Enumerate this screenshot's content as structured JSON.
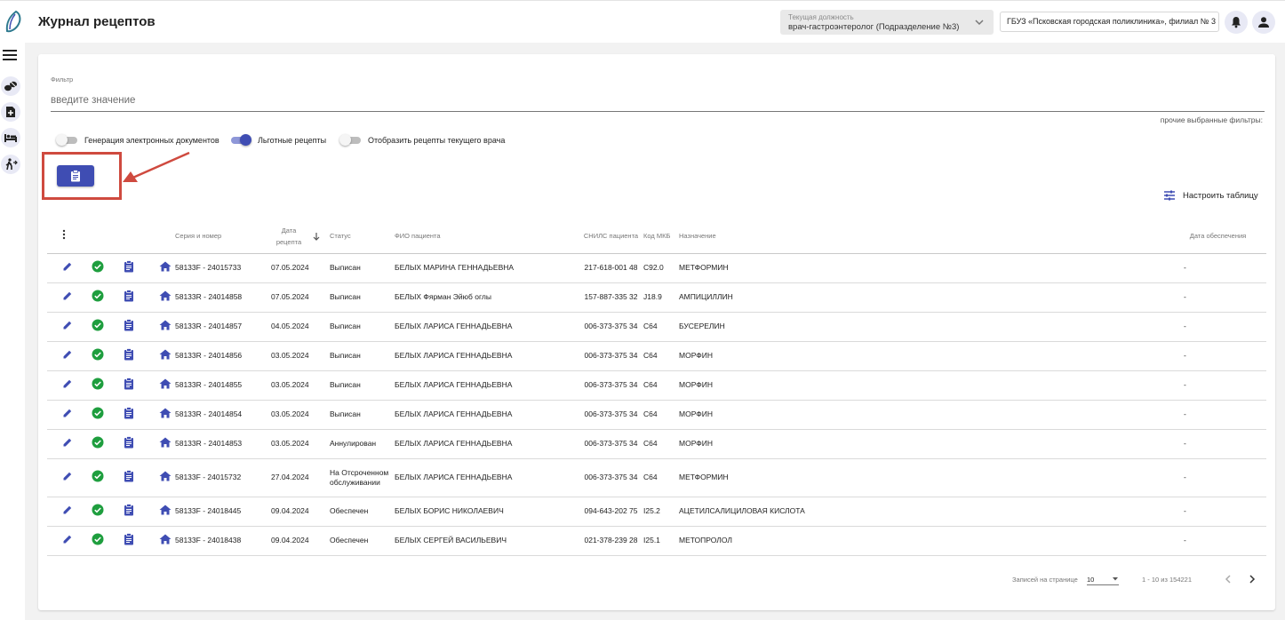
{
  "header": {
    "title": "Журнал рецептов",
    "position_label": "Текущая должность",
    "position_value": "врач-гастроэнтеролог (Подразделение №3)",
    "organization": "ГБУЗ «Псковская городская поликлиника», филиал № 3"
  },
  "filter": {
    "label": "Фильтр",
    "placeholder": "введите значение",
    "other_filters": "прочие выбранные фильтры:"
  },
  "toggles": [
    {
      "label": "Генерация электронных документов",
      "on": false
    },
    {
      "label": "Льготные рецепты",
      "on": true
    },
    {
      "label": "Отобразить рецепты текущего врача",
      "on": false
    }
  ],
  "config_label": "Настроить таблицу",
  "columns": {
    "series": "Серия и номер",
    "date": "Дата рецепта",
    "status": "Статус",
    "fio": "ФИО пациента",
    "snils": "СНИЛС пациента",
    "mkb": "Код МКБ",
    "nazn": "Назначение",
    "supply_date": "Дата обеспечения"
  },
  "rows": [
    {
      "series": "58133F - 24015733",
      "date": "07.05.2024",
      "status": "Выписан",
      "fio": "БЕЛЫХ МАРИНА ГЕННАДЬЕВНА",
      "snils": "217-618-001 48",
      "mkb": "C92.0",
      "nazn": "МЕТФОРМИН",
      "supply": "-"
    },
    {
      "series": "58133R - 24014858",
      "date": "07.05.2024",
      "status": "Выписан",
      "fio": "БЕЛЫХ Фярман Эйюб оглы",
      "snils": "157-887-335 32",
      "mkb": "J18.9",
      "nazn": "АМПИЦИЛЛИН",
      "supply": "-"
    },
    {
      "series": "58133R - 24014857",
      "date": "04.05.2024",
      "status": "Выписан",
      "fio": "БЕЛЫХ ЛАРИСА ГЕННАДЬЕВНА",
      "snils": "006-373-375 34",
      "mkb": "C64",
      "nazn": "БУСЕРЕЛИН",
      "supply": "-"
    },
    {
      "series": "58133R - 24014856",
      "date": "03.05.2024",
      "status": "Выписан",
      "fio": "БЕЛЫХ ЛАРИСА ГЕННАДЬЕВНА",
      "snils": "006-373-375 34",
      "mkb": "C64",
      "nazn": "МОРФИН",
      "supply": "-"
    },
    {
      "series": "58133R - 24014855",
      "date": "03.05.2024",
      "status": "Выписан",
      "fio": "БЕЛЫХ ЛАРИСА ГЕННАДЬЕВНА",
      "snils": "006-373-375 34",
      "mkb": "C64",
      "nazn": "МОРФИН",
      "supply": "-"
    },
    {
      "series": "58133R - 24014854",
      "date": "03.05.2024",
      "status": "Выписан",
      "fio": "БЕЛЫХ ЛАРИСА ГЕННАДЬЕВНА",
      "snils": "006-373-375 34",
      "mkb": "C64",
      "nazn": "МОРФИН",
      "supply": "-"
    },
    {
      "series": "58133R - 24014853",
      "date": "03.05.2024",
      "status": "Аннулирован",
      "fio": "БЕЛЫХ ЛАРИСА ГЕННАДЬЕВНА",
      "snils": "006-373-375 34",
      "mkb": "C64",
      "nazn": "МОРФИН",
      "supply": "-"
    },
    {
      "series": "58133F - 24015732",
      "date": "27.04.2024",
      "status": "На Отсроченном обслуживании",
      "fio": "БЕЛЫХ ЛАРИСА ГЕННАДЬЕВНА",
      "snils": "006-373-375 34",
      "mkb": "C64",
      "nazn": "МЕТФОРМИН",
      "supply": "-"
    },
    {
      "series": "58133F - 24018445",
      "date": "09.04.2024",
      "status": "Обеспечен",
      "fio": "БЕЛЫХ БОРИС НИКОЛАЕВИЧ",
      "snils": "094-643-202 75",
      "mkb": "I25.2",
      "nazn": "АЦЕТИЛСАЛИЦИЛОВАЯ КИСЛОТА",
      "supply": "-"
    },
    {
      "series": "58133F - 24018438",
      "date": "09.04.2024",
      "status": "Обеспечен",
      "fio": "БЕЛЫХ СЕРГЕЙ ВАСИЛЬЕВИЧ",
      "snils": "021-378-239 28",
      "mkb": "I25.1",
      "nazn": "МЕТОПРОЛОЛ",
      "supply": "-"
    }
  ],
  "pager": {
    "rows_label": "Записей на странице",
    "rows_value": "10",
    "range": "1 - 10 из 154221"
  },
  "colors": {
    "primary": "#3f4db3",
    "success": "#1e9e3e",
    "highlight": "#cf4a3f"
  },
  "icons": [
    "logo-icon",
    "chevron-down-icon",
    "bell-icon",
    "user-icon",
    "hamburger-icon",
    "pills-icon",
    "document-add-icon",
    "bed-icon",
    "walking-icon",
    "clipboard-icon",
    "tune-icon",
    "more-vert-icon",
    "arrow-down-icon",
    "pencil-icon",
    "check-circle-icon",
    "home-icon",
    "chevron-left-icon",
    "chevron-right-icon"
  ]
}
